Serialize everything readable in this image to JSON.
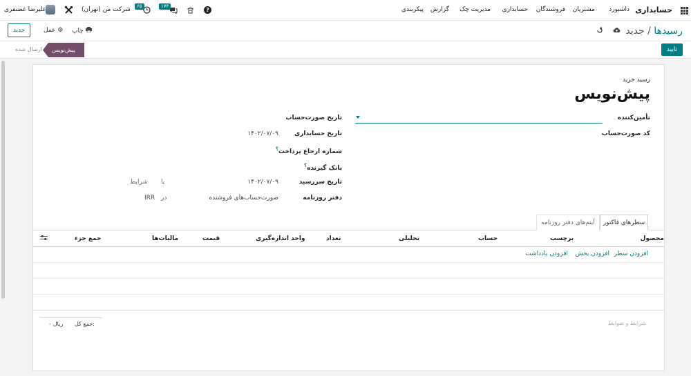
{
  "topbar": {
    "brand": "حسابداری",
    "menu": [
      "داشبورد",
      "مشتریان",
      "فروشندگان",
      "حسابداری",
      "مدیریت چک",
      "گزارش",
      "پیکربندی"
    ],
    "company": "شرکت من (تهران)",
    "user": "علیرضا غضنفری",
    "activity_badge": "۶۵",
    "messages_badge": "۱۷۳",
    "icons": [
      "apps-icon",
      "help-icon",
      "phone-icon",
      "chat-icon",
      "clock-icon",
      "tools-icon"
    ]
  },
  "control_panel": {
    "new_label": "جدید",
    "action_label": "عمل",
    "print_label": "چاپ",
    "breadcrumb_parent": "رسیدها",
    "breadcrumb_sep": " / ",
    "breadcrumb_current": "جدید"
  },
  "status": {
    "confirm_label": "تایید",
    "stage_active": "پیش‌نویس",
    "stage_next": "ارسال شده"
  },
  "form": {
    "doc_type": "رسید خرید",
    "doc_title": "پیش‌نویس",
    "vendor_label": "تأمین‌کننده",
    "bill_ref_label": "کد صورت‌حساب",
    "bill_date_label": "تاریخ صورت‌حساب",
    "accounting_date_label": "تاریخ حسابداری",
    "accounting_date_value": "۱۴۰۲/۰۷/۰۹",
    "payment_ref_label": "شماره ارجاع پرداخت",
    "bank_label": "بانک گیرنده",
    "due_date_label": "تاریخ سررسید",
    "due_date_value": "۱۴۰۲/۰۷/۰۹",
    "or_label": "یا",
    "terms_label": "شرایط",
    "journal_label": "دفتر روزنامه",
    "journal_value": "صورت‌حساب‌های فروشنده",
    "in_label": "در",
    "currency": "IRR",
    "help_mark": "؟"
  },
  "tabs": [
    "سطرهای فاکتور",
    "آیتم‌های دفتر روزنامه"
  ],
  "table": {
    "columns": [
      "محصول",
      "برچسب",
      "حساب",
      "تحلیلی",
      "تعداد",
      "واحد اندازه‌گیری",
      "قیمت",
      "مالیات‌ها",
      "جمع جزء"
    ],
    "add_line": "افزودن سطر",
    "add_section": "افزودن بخش",
    "add_note": "افزودن یادداشت"
  },
  "footer": {
    "terms_placeholder": "شرایط و ضوابط",
    "total_label": "جمع کل:",
    "total_value": "ریال ۰"
  }
}
